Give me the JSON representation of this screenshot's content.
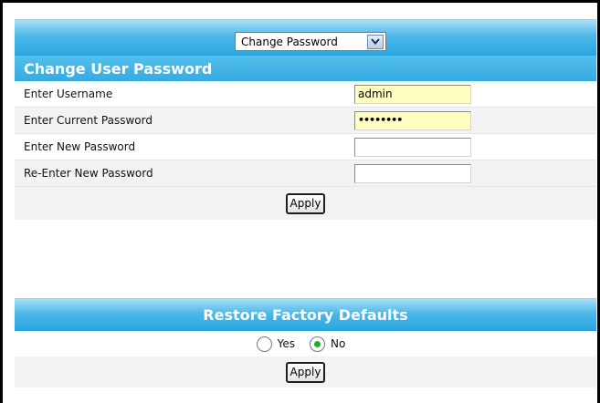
{
  "selector": {
    "value": "Change Password"
  },
  "change_password": {
    "title": "Change User Password",
    "fields": [
      {
        "label": "Enter Username",
        "value": "admin"
      },
      {
        "label": "Enter Current Password",
        "value": "••••••••"
      },
      {
        "label": "Enter New Password",
        "value": ""
      },
      {
        "label": "Re-Enter New Password",
        "value": ""
      }
    ],
    "apply_label": "Apply"
  },
  "restore": {
    "title": "Restore Factory Defaults",
    "options": [
      {
        "label": "Yes",
        "selected": false
      },
      {
        "label": "No",
        "selected": true
      }
    ],
    "apply_label": "Apply"
  },
  "colors": {
    "header_blue": "#35abe2",
    "filled_field": "#ffffc0",
    "radio_selected": "#25a82b"
  }
}
